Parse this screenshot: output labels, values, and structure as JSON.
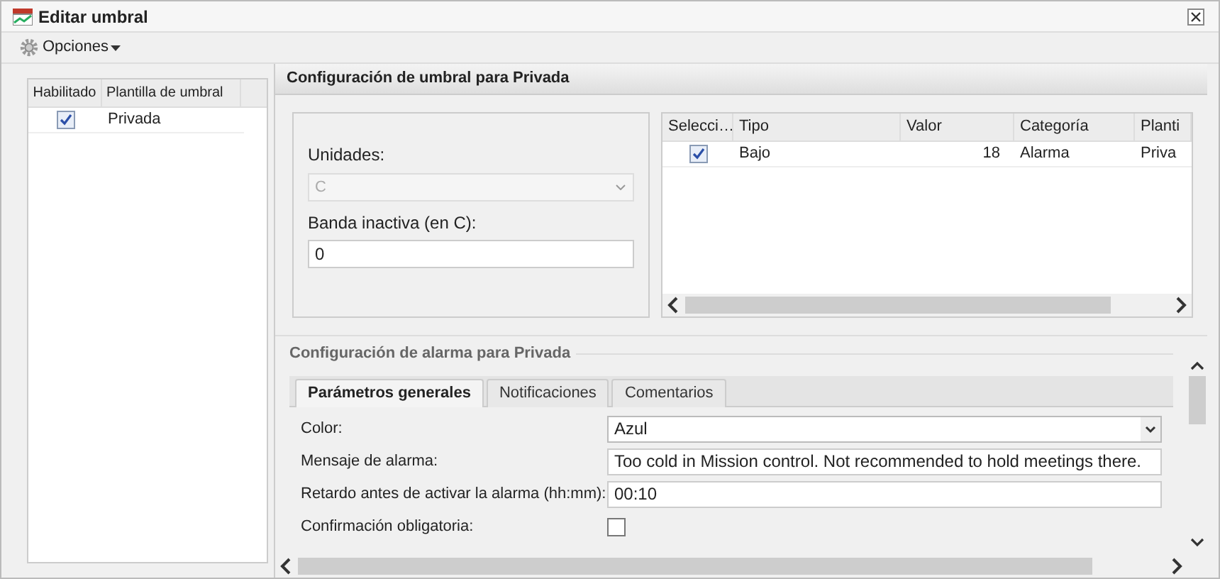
{
  "window": {
    "title": "Editar umbral"
  },
  "toolbar": {
    "menu": "Opciones"
  },
  "templates": {
    "columns": [
      "Habilitado",
      "Plantilla de umbral"
    ],
    "rows": [
      {
        "enabled": true,
        "name": "Privada"
      }
    ]
  },
  "threshold": {
    "title": "Configuración de umbral para Privada",
    "units": {
      "label": "Unidades:",
      "value": "C",
      "disabled": true
    },
    "deadband": {
      "label": "Banda inactiva (en C):",
      "value": "0"
    }
  },
  "thresholds_table": {
    "columns": [
      "Selecci…",
      "Tipo",
      "Valor",
      "Categoría",
      "Planti"
    ],
    "rows": [
      {
        "selected": true,
        "type": "Bajo",
        "value": "18",
        "category": "Alarma",
        "template": "Priva"
      }
    ]
  },
  "alarm": {
    "title": "Configuración de alarma para Privada",
    "tabs": [
      {
        "label": "Parámetros generales",
        "selected": true
      },
      {
        "label": "Notificaciones",
        "selected": false
      },
      {
        "label": "Comentarios",
        "selected": false
      }
    ],
    "fields": [
      {
        "kind": "select",
        "label": "Color:",
        "value": "Azul"
      },
      {
        "kind": "text",
        "label": "Mensaje de alarma:",
        "value": "Too cold in Mission control. Not recommended to hold meetings there."
      },
      {
        "kind": "text",
        "label": "Retardo antes de activar la alarma (hh:mm):",
        "value": "00:10"
      },
      {
        "kind": "checkbox",
        "label": "Confirmación obligatoria:",
        "checked": false
      }
    ]
  }
}
